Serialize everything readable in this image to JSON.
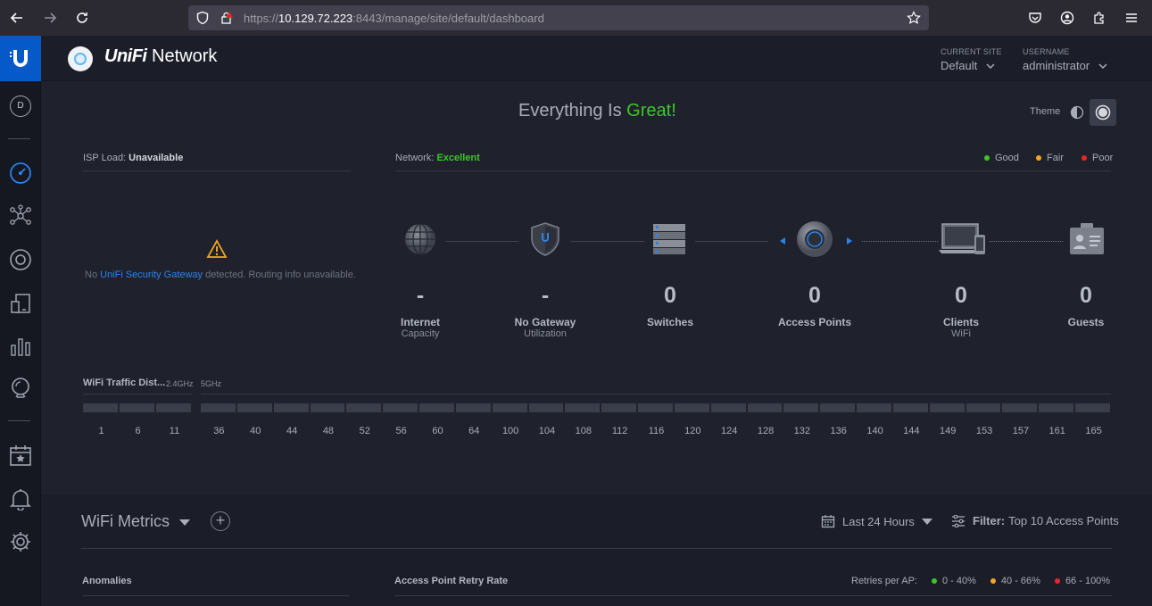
{
  "browser": {
    "url_prefix": "https://",
    "url_host": "10.129.72.223",
    "url_rest": ":8443/manage/site/default/dashboard"
  },
  "header": {
    "brand_unifi": "UniFi",
    "brand_network": " Network",
    "current_site_label": "CURRENT SITE",
    "current_site_value": "Default",
    "username_label": "USERNAME",
    "username_value": "administrator"
  },
  "sidebar": {
    "site_badge": "D"
  },
  "dashboard": {
    "status_prefix": "Everything Is ",
    "status_value": "Great!",
    "theme_label": "Theme",
    "isp_label": "ISP Load: ",
    "isp_value": "Unavailable",
    "isp_msg_prefix": "No ",
    "isp_msg_link": "UniFi Security Gateway",
    "isp_msg_suffix": " detected. Routing info unavailable.",
    "network_label": "Network: ",
    "network_value": "Excellent",
    "legend": [
      {
        "label": "Good",
        "color": "#3fc52a"
      },
      {
        "label": "Fair",
        "color": "#f5a623"
      },
      {
        "label": "Poor",
        "color": "#e8262a"
      }
    ],
    "devices": [
      {
        "icon": "globe-icon",
        "count": "-",
        "name": "Internet",
        "sub": "Capacity"
      },
      {
        "icon": "gateway-shield-icon",
        "count": "-",
        "name": "No Gateway",
        "sub": "Utilization"
      },
      {
        "icon": "switch-icon",
        "count": "0",
        "name": "Switches",
        "sub": ""
      },
      {
        "icon": "access-point-icon",
        "count": "0",
        "name": "Access Points",
        "sub": ""
      },
      {
        "icon": "laptop-phone-icon",
        "count": "0",
        "name": "Clients",
        "sub": "WiFi"
      },
      {
        "icon": "guest-badge-icon",
        "count": "0",
        "name": "Guests",
        "sub": ""
      }
    ],
    "wifi_title": "WiFi Traffic Dist...",
    "band_24": "2.4GHz",
    "band_5": "5GHz",
    "channels_24": [
      "1",
      "6",
      "11"
    ],
    "channels_5": [
      "36",
      "40",
      "44",
      "48",
      "52",
      "56",
      "60",
      "64",
      "100",
      "104",
      "108",
      "112",
      "116",
      "120",
      "124",
      "128",
      "132",
      "136",
      "140",
      "144",
      "149",
      "153",
      "157",
      "161",
      "165"
    ]
  },
  "metrics": {
    "title": "WiFi Metrics",
    "range": "Last 24 Hours",
    "filter_label": "Filter:",
    "filter_value": "Top 10 Access Points",
    "anomalies": "Anomalies",
    "retry_rate": "Access Point Retry Rate",
    "retries_label": "Retries per AP:",
    "retry_legend": [
      {
        "label": "0 - 40%",
        "color": "#3fc52a"
      },
      {
        "label": "40 - 66%",
        "color": "#f5a623"
      },
      {
        "label": "66 - 100%",
        "color": "#e8262a"
      }
    ]
  }
}
